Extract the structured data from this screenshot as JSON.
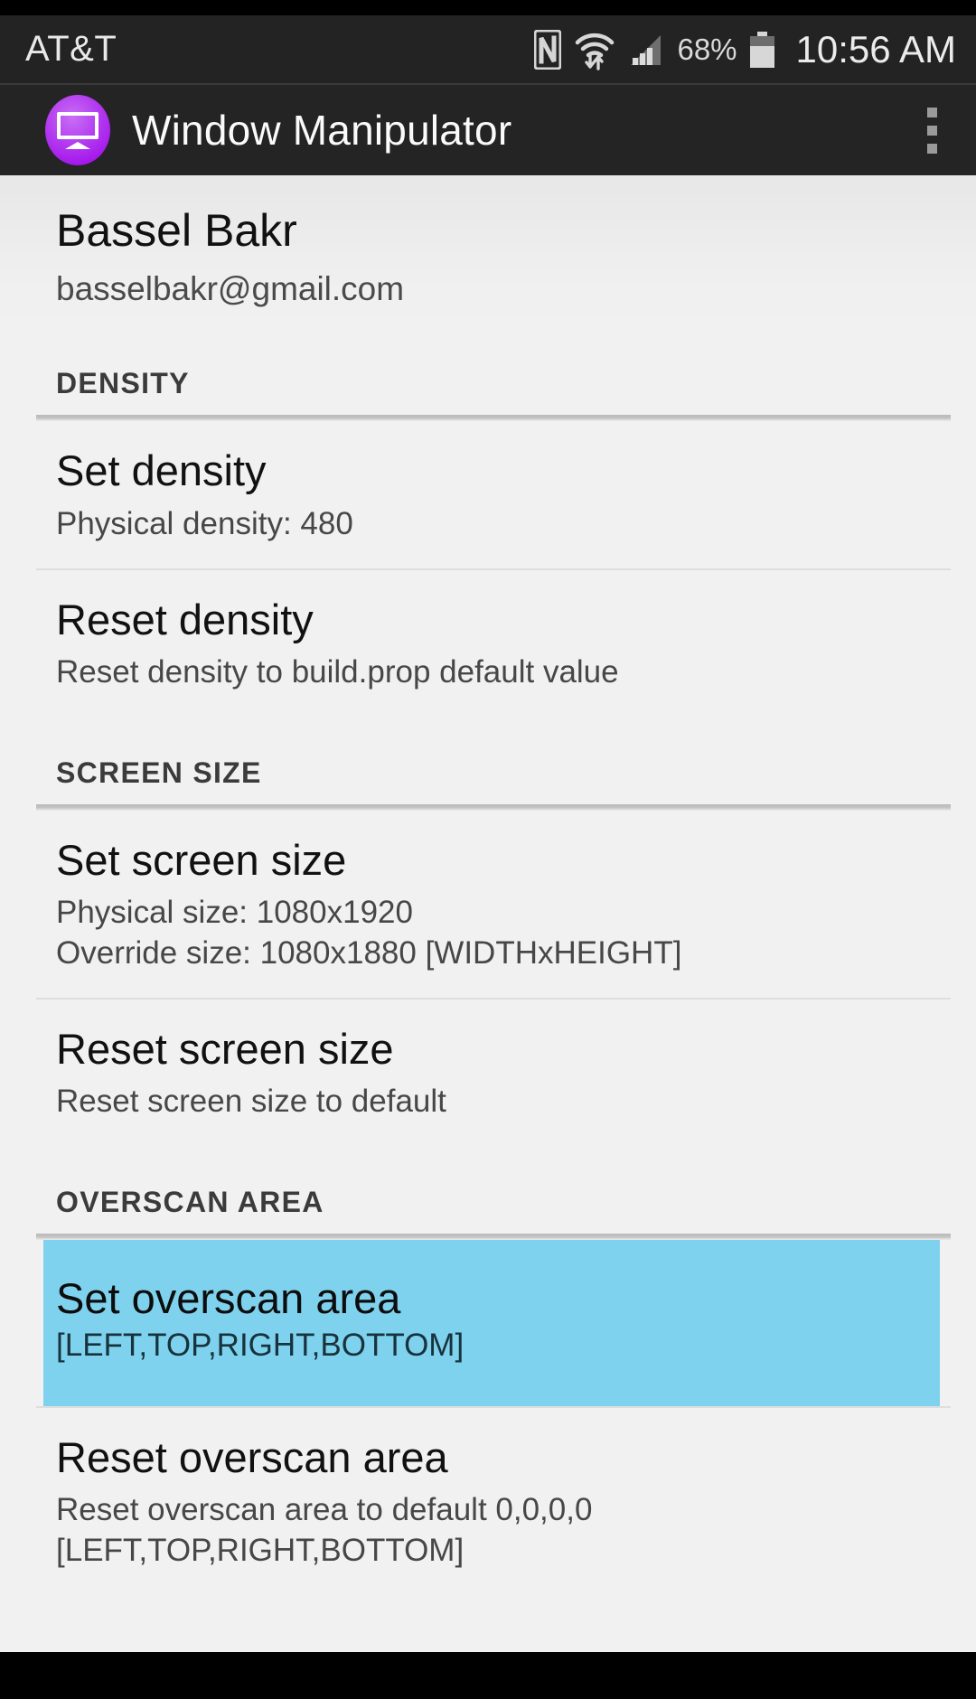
{
  "status_bar": {
    "carrier": "AT&T",
    "battery_percent": "68%",
    "clock": "10:56 AM",
    "icons": [
      "nfc-icon",
      "wifi-icon",
      "signal-icon",
      "battery-icon"
    ]
  },
  "app_bar": {
    "title": "Window Manipulator",
    "icon": "monitor-app-icon",
    "overflow": "overflow-menu-icon"
  },
  "account": {
    "name": "Bassel Bakr",
    "email": "basselbakr@gmail.com"
  },
  "colors": {
    "accent": "#9b00e8",
    "highlight": "#7fd2ee",
    "app_bar_bg": "#242424",
    "status_bar_bg": "#232323",
    "page_bg": "#f1f1f1"
  },
  "sections": [
    {
      "header": "DENSITY",
      "items": [
        {
          "title": "Set density",
          "subtitle_lines": [
            "Physical density: 480"
          ],
          "selected": false
        },
        {
          "title": "Reset density",
          "subtitle_lines": [
            "Reset density to build.prop default value"
          ],
          "selected": false
        }
      ]
    },
    {
      "header": "SCREEN SIZE",
      "items": [
        {
          "title": "Set screen size",
          "subtitle_lines": [
            "Physical size: 1080x1920",
            "Override size: 1080x1880 [WIDTHxHEIGHT]"
          ],
          "selected": false
        },
        {
          "title": "Reset screen size",
          "subtitle_lines": [
            "Reset screen size to default"
          ],
          "selected": false
        }
      ]
    },
    {
      "header": "OVERSCAN AREA",
      "items": [
        {
          "title": "Set overscan area",
          "subtitle_lines": [
            "[LEFT,TOP,RIGHT,BOTTOM]"
          ],
          "selected": true
        },
        {
          "title": "Reset overscan area",
          "subtitle_lines": [
            "Reset overscan area to default 0,0,0,0",
            "[LEFT,TOP,RIGHT,BOTTOM]"
          ],
          "selected": false
        }
      ]
    }
  ]
}
